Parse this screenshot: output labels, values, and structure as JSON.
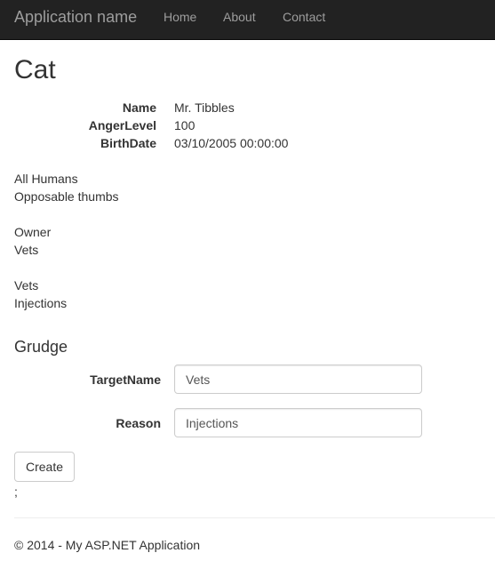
{
  "navbar": {
    "brand": "Application name",
    "links": [
      "Home",
      "About",
      "Contact"
    ]
  },
  "page": {
    "title": "Cat"
  },
  "details": [
    {
      "label": "Name",
      "value": "Mr. Tibbles"
    },
    {
      "label": "AngerLevel",
      "value": "100"
    },
    {
      "label": "BirthDate",
      "value": "03/10/2005 00:00:00"
    }
  ],
  "lines": {
    "group1": [
      "All Humans",
      "Opposable thumbs"
    ],
    "group2": [
      "Owner",
      "Vets"
    ],
    "group3": [
      "Vets",
      "Injections"
    ]
  },
  "grudge_form": {
    "heading": "Grudge",
    "target_name_label": "TargetName",
    "target_name_value": "Vets",
    "reason_label": "Reason",
    "reason_value": "Injections",
    "submit_label": "Create",
    "trailing_text": ";"
  },
  "footer": {
    "text": "© 2014 - My ASP.NET Application"
  }
}
